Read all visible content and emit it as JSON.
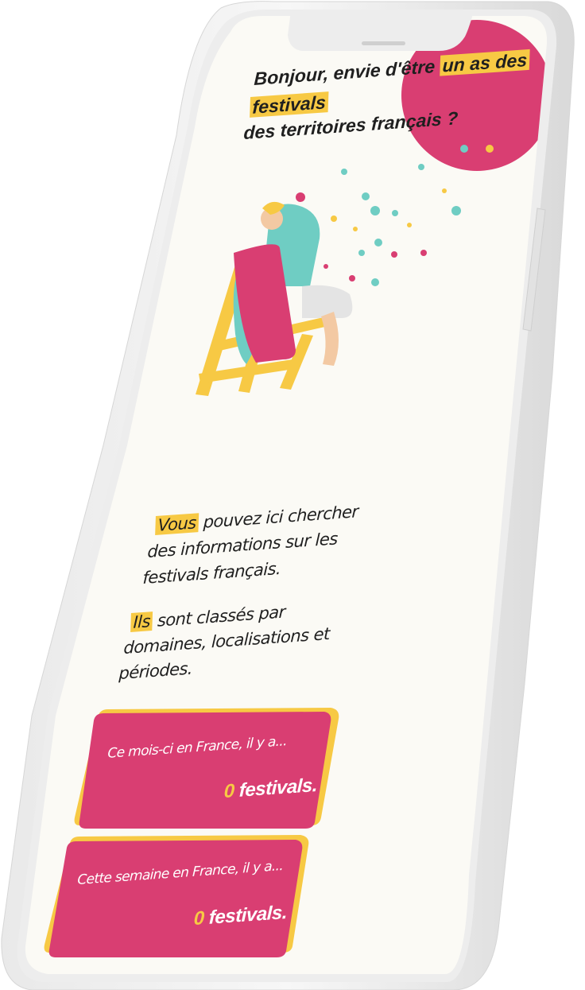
{
  "intro": {
    "line1_prefix": "Bonjour, envie d'être ",
    "line1_highlight": "un as des",
    "line2_highlight": "festivals",
    "line3": "des territoires français ?"
  },
  "description": {
    "p1_highlight": "Vous",
    "p1_line1_rest": " pouvez ici chercher",
    "p1_line2": "des informations sur les",
    "p1_line3": "festivals français.",
    "p2_highlight": "Ils",
    "p2_line1_rest": " sont classés par",
    "p2_line2": "domaines, localisations et",
    "p2_line3": "périodes."
  },
  "cards": [
    {
      "label": "Ce mois-ci en France, il y a...",
      "count": "0",
      "unit": " festivals."
    },
    {
      "label": "Cette semaine en France, il y a...",
      "count": "0",
      "unit": " festivals."
    }
  ],
  "colors": {
    "accent_pink": "#d93e72",
    "accent_yellow": "#f7c944",
    "screen_bg": "#fbfaf5",
    "frame": "#f1f1f1"
  },
  "icons": {
    "hero_illustration": "person-in-deckchair-with-confetti"
  }
}
